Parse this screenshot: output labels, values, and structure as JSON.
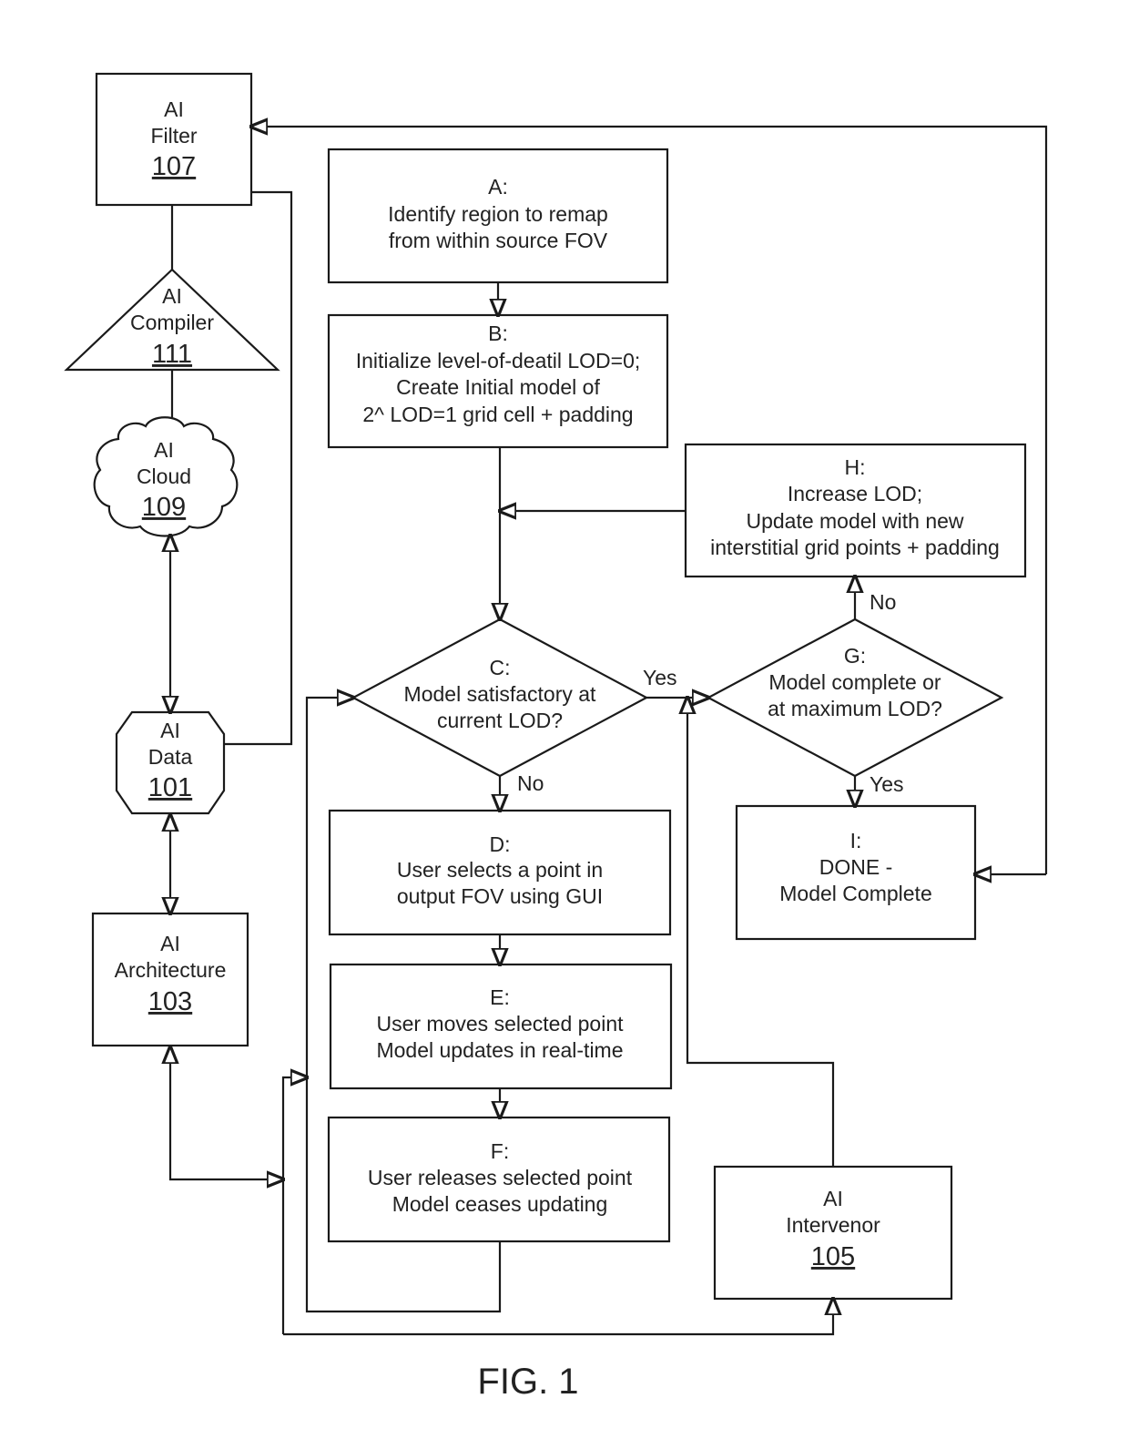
{
  "figure_caption": "FIG. 1",
  "components": {
    "filter": {
      "line1": "AI",
      "line2": "Filter",
      "ref": "107"
    },
    "compiler": {
      "line1": "AI",
      "line2": "Compiler",
      "ref": "111"
    },
    "cloud": {
      "line1": "AI",
      "line2": "Cloud",
      "ref": "109"
    },
    "data": {
      "line1": "AI",
      "line2": "Data",
      "ref": "101"
    },
    "architecture": {
      "line1": "AI",
      "line2": "Architecture",
      "ref": "103"
    },
    "intervenor": {
      "line1": "AI",
      "line2": "Intervenor",
      "ref": "105"
    }
  },
  "steps": {
    "A": {
      "label": "A:",
      "lines": [
        "Identify region to remap",
        "from within source FOV"
      ]
    },
    "B": {
      "label": "B:",
      "lines": [
        "Initialize level-of-deatil LOD=0;",
        "Create Initial model of",
        "2^ LOD=1 grid cell + padding"
      ]
    },
    "C": {
      "label": "C:",
      "lines": [
        "Model satisfactory at",
        "current LOD?"
      ]
    },
    "D": {
      "label": "D:",
      "lines": [
        "User selects a point in",
        "output FOV using GUI"
      ]
    },
    "E": {
      "label": "E:",
      "lines": [
        "User moves selected point",
        "Model updates in real-time"
      ]
    },
    "F": {
      "label": "F:",
      "lines": [
        "User releases selected point",
        "Model ceases updating"
      ]
    },
    "G": {
      "label": "G:",
      "lines": [
        "Model complete or",
        "at maximum LOD?"
      ]
    },
    "H": {
      "label": "H:",
      "lines": [
        "Increase LOD;",
        "Update model with new",
        "interstitial grid points + padding"
      ]
    },
    "I": {
      "label": "I:",
      "lines": [
        "DONE -",
        "Model Complete"
      ]
    }
  },
  "branch_labels": {
    "c_yes": "Yes",
    "c_no": "No",
    "g_yes": "Yes",
    "g_no": "No"
  }
}
